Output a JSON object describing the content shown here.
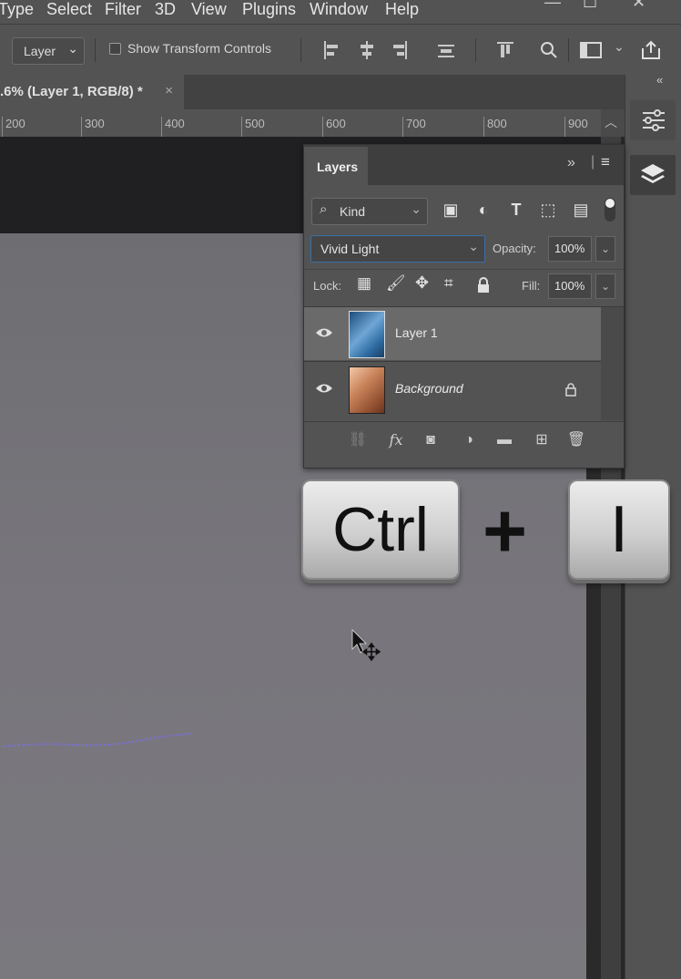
{
  "menubar": {
    "items": [
      "Type",
      "Select",
      "Filter",
      "3D",
      "View",
      "Plugins",
      "Window",
      "Help"
    ]
  },
  "options": {
    "tool_mode": "Layer",
    "show_transform_label": "Show Transform Controls"
  },
  "document": {
    "tab_title": ".6% (Layer 1, RGB/8) *",
    "close_glyph": "×"
  },
  "ruler": {
    "ticks": [
      "200",
      "300",
      "400",
      "500",
      "600",
      "700",
      "800",
      "900"
    ]
  },
  "layers_panel": {
    "title": "Layers",
    "filter_kind": "Kind",
    "blend_mode": "Vivid Light",
    "opacity_label": "Opacity:",
    "opacity_value": "100%",
    "lock_label": "Lock:",
    "fill_label": "Fill:",
    "fill_value": "100%",
    "layers": [
      {
        "name": "Layer 1",
        "visible": true,
        "selected": true
      },
      {
        "name": "Background",
        "visible": true,
        "locked": true
      }
    ]
  },
  "shortcut": {
    "key1": "Ctrl",
    "plus": "+",
    "key2": "I"
  },
  "colors": {
    "accent_blue": "#3b6ea9",
    "panel_bg": "#535353"
  }
}
